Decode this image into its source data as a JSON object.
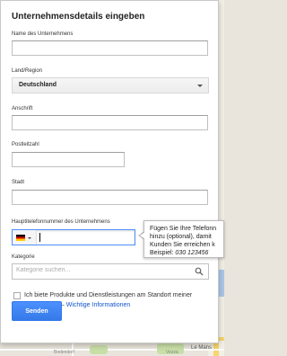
{
  "dialog": {
    "title": "Unternehmensdetails eingeben",
    "fields": {
      "name_label": "Name des Unternehmens",
      "region_label": "Land/Region",
      "region_value": "Deutschland",
      "address_label": "Anschrift",
      "zip_label": "Postleitzahl",
      "city_label": "Stadt",
      "phone_label": "Hauptitelefonnummer des Unternehmens",
      "category_label": "Kategorie",
      "category_placeholder": "Kategorie suchen..."
    },
    "phone_tooltip": {
      "line1": "Fügen Sie Ihre Telefonn",
      "line2": "hinzu (optional), damit",
      "line3": "Kunden Sie erreichen k",
      "line4_prefix": "Beispiel:",
      "line4_example": "030 123456"
    },
    "checkbox": {
      "text": "Ich biete Produkte und Dienstleistungen am Standort meiner Kunden an. —",
      "link": "Wichtige Informationen",
      "checked": false
    },
    "submit_label": "Senden"
  },
  "map": {
    "labels": [
      "Bodendorf",
      "Le Mans",
      "Vezza"
    ]
  },
  "colors": {
    "primary_button": "#4d90fe",
    "link": "#1155cc",
    "focus_border": "#4d90fe"
  }
}
